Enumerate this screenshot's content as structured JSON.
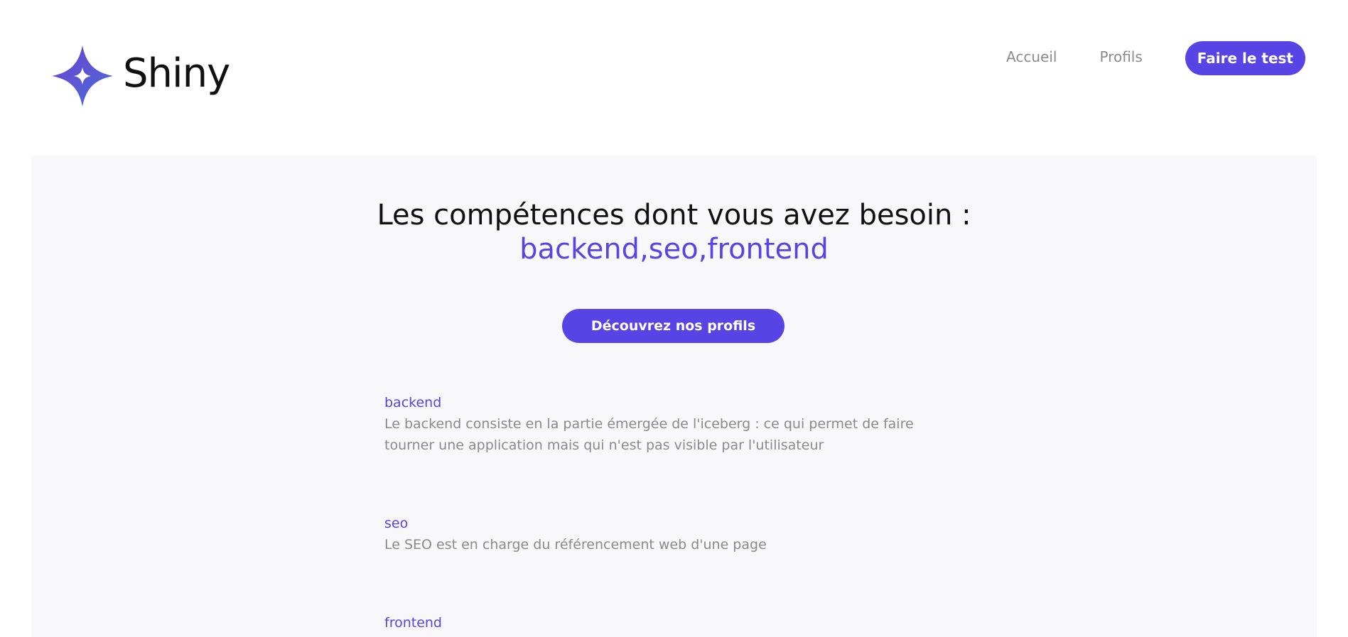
{
  "brand": {
    "name": "Shiny",
    "accent_color": "#5843e4"
  },
  "nav": {
    "items": [
      {
        "label": "Accueil"
      },
      {
        "label": "Profils"
      }
    ],
    "cta_label": "Faire le test"
  },
  "results": {
    "title": "Les compétences dont vous avez besoin :",
    "skills_list": "backend,seo,frontend",
    "discover_button": "Découvrez nos profils",
    "descriptions": [
      {
        "title": "backend",
        "text": "Le backend consiste en la partie émergée de l'iceberg : ce qui permet de faire tourner une application mais qui n'est pas visible par l'utilisateur"
      },
      {
        "title": "seo",
        "text": "Le SEO est en charge du référencement web d'une page"
      },
      {
        "title": "frontend",
        "text": ""
      }
    ]
  }
}
